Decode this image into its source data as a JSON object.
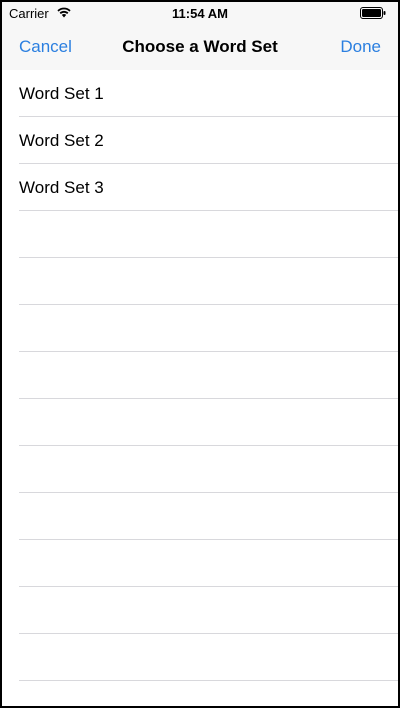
{
  "status_bar": {
    "carrier": "Carrier",
    "time": "11:54 AM",
    "wifi_icon": "wifi-icon",
    "battery_icon": "battery-icon"
  },
  "nav": {
    "cancel_label": "Cancel",
    "title": "Choose a Word Set",
    "done_label": "Done",
    "accent_color": "#2b7fe0"
  },
  "word_sets": [
    {
      "label": "Word Set 1"
    },
    {
      "label": "Word Set 2"
    },
    {
      "label": "Word Set 3"
    }
  ],
  "empty_rows": 10
}
